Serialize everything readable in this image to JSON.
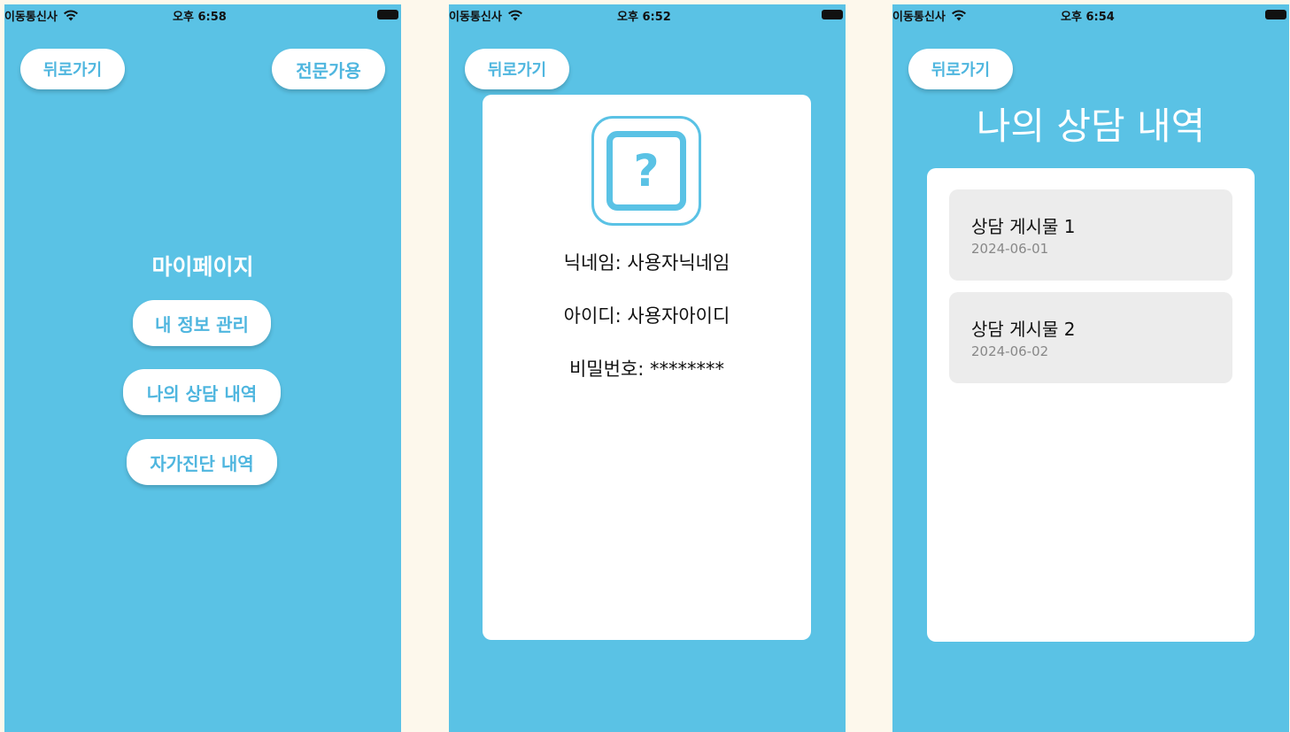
{
  "status_bar": {
    "carrier": "이동통신사",
    "screens_time": [
      "오후 6:58",
      "오후 6:52",
      "오후 6:54"
    ]
  },
  "screen1": {
    "back_label": "뒤로가기",
    "expert_label": "전문가용",
    "title": "마이페이지",
    "menu": [
      "내 정보 관리",
      "나의 상담 내역",
      "자가진단 내역"
    ]
  },
  "screen2": {
    "back_label": "뒤로가기",
    "avatar_glyph": "?",
    "nickname_line": "닉네임: 사용자닉네임",
    "id_line": "아이디: 사용자아이디",
    "password_line": "비밀번호: ********"
  },
  "screen3": {
    "back_label": "뒤로가기",
    "title": "나의 상담 내역",
    "posts": [
      {
        "title": "상담 게시물 1",
        "date": "2024-06-01"
      },
      {
        "title": "상담 게시물 2",
        "date": "2024-06-02"
      }
    ]
  },
  "colors": {
    "background": "#5ac2e5",
    "accent_text": "#4fb6df",
    "page": "#fdf8ec"
  }
}
